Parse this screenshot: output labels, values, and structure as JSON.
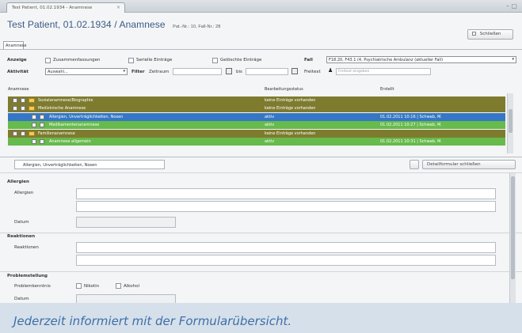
{
  "window": {
    "tab_title": "Test Patient, 01.02.1934 - Anamnese",
    "tab_close": "×",
    "window_controls": "– ▢"
  },
  "header": {
    "title": "Test Patient, 01.02.1934 / Anamnese",
    "subtitle": "Pat.-Nr.: 10, Fall-Nr.: 28",
    "close_label": "Schließen",
    "view_tab": "Anamnese"
  },
  "filters": {
    "anzeige_label": "Anzeige",
    "opt1": "Zusammenfassungen",
    "opt2": "Serielle Einträge",
    "opt3": "Gelöschte Einträge",
    "fall_label": "Fall",
    "fall_value": "F18.20, F43.1 (4, Psychiatrische Ambulanz (aktueller Fall)",
    "aktivitaet_label": "Aktivität",
    "aktivitaet_value": "Auswahl...",
    "filter_label": "Filter",
    "zeitraum_label": "Zeitraum",
    "bis_label": "bis",
    "freitext_label": "Freitext",
    "freitext_placeholder": "Freitext eingeben"
  },
  "grid": {
    "columns": [
      "Anamnese",
      "Bearbeitungsstatus",
      "Erstellt"
    ],
    "rows": [
      {
        "name": "Sozialanamnese/Biographie",
        "status": "keine Einträge vorhanden",
        "created": "",
        "color": "olive",
        "level": 0
      },
      {
        "name": "Medizinische Anamnese",
        "status": "keine Einträge vorhanden",
        "created": "",
        "color": "olive",
        "level": 0
      },
      {
        "name": "Allergien, Unverträglichkeiten, Noxen",
        "status": "aktiv",
        "created": "01.02.2011 10:16 | Schwab, M.",
        "color": "blue",
        "level": 1
      },
      {
        "name": "Medikamentenanamnese",
        "status": "aktiv",
        "created": "01.02.2011 10:27 | Schwab, M.",
        "color": "green",
        "level": 1
      },
      {
        "name": "Familienanamnese",
        "status": "keine Einträge vorhanden",
        "created": "",
        "color": "olive",
        "level": 0
      },
      {
        "name": "Anamnese allgemein",
        "status": "aktiv",
        "created": "01.02.2011 10:31 | Schwab, M.",
        "color": "green",
        "level": 1
      }
    ]
  },
  "form": {
    "tab_label": "Allergien, Unverträglichkeiten, Noxen",
    "overview_button": "Detailformular schließen",
    "section1": "Allergien",
    "field_allergien": "Allergien",
    "field_datum": "Datum",
    "section2": "Reaktionen",
    "field_reaktionen": "Reaktionen",
    "section3": "Problemstellung",
    "field_prob": "Problemkenntnis",
    "opt_nikotin": "Nikotin",
    "opt_alkohol": "Alkohol",
    "field_datum2": "Datum"
  },
  "caption": "Jederzeit informiert mit der Formularübersicht."
}
